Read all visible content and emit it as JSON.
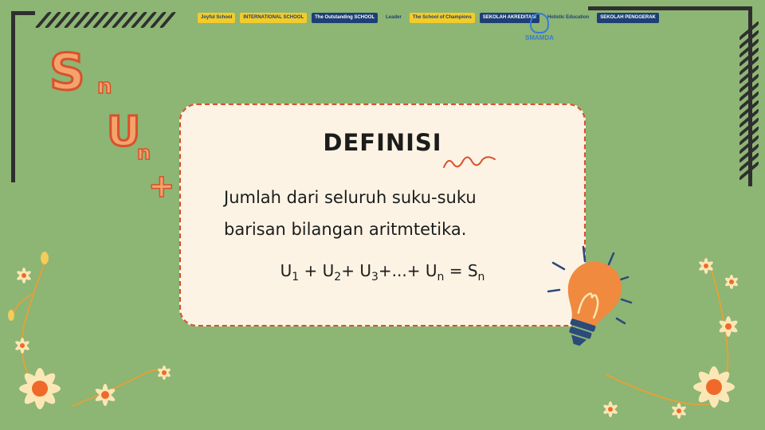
{
  "slide": {
    "title": "DEFINISI",
    "body_line1": "Jumlah dari seluruh suku-suku",
    "body_line2": "barisan bilangan aritmtetika.",
    "formula": {
      "u": "U",
      "i1": "1",
      "plus": "+",
      "i2": "2",
      "i3": "3",
      "ellipsis": "+...+",
      "n": "n",
      "equals": "=",
      "s": "S"
    }
  },
  "decor": {
    "s_letter": "S",
    "s_sub": "n",
    "u_letter": "U",
    "u_sub": "n",
    "plus_sign": "+"
  },
  "logos": [
    "Joyful School",
    "INTERNATIONAL SCHOOL",
    "The Outstanding SCHOOL",
    "Leader",
    "The School of Champions",
    "SEKOLAH AKREDITASI",
    "Holistic Education",
    "SEKOLAH PENGGERAK"
  ],
  "school_name": "SMAMDA",
  "colors": {
    "background": "#8db574",
    "card": "#fcf3e4",
    "accent": "#d9512c",
    "letter_fill": "#f4a36c",
    "bulb": "#f08a3e",
    "flower": "#fbe7b5"
  },
  "icons": [
    "lightbulb-icon",
    "flower-icon",
    "squiggle-icon"
  ]
}
